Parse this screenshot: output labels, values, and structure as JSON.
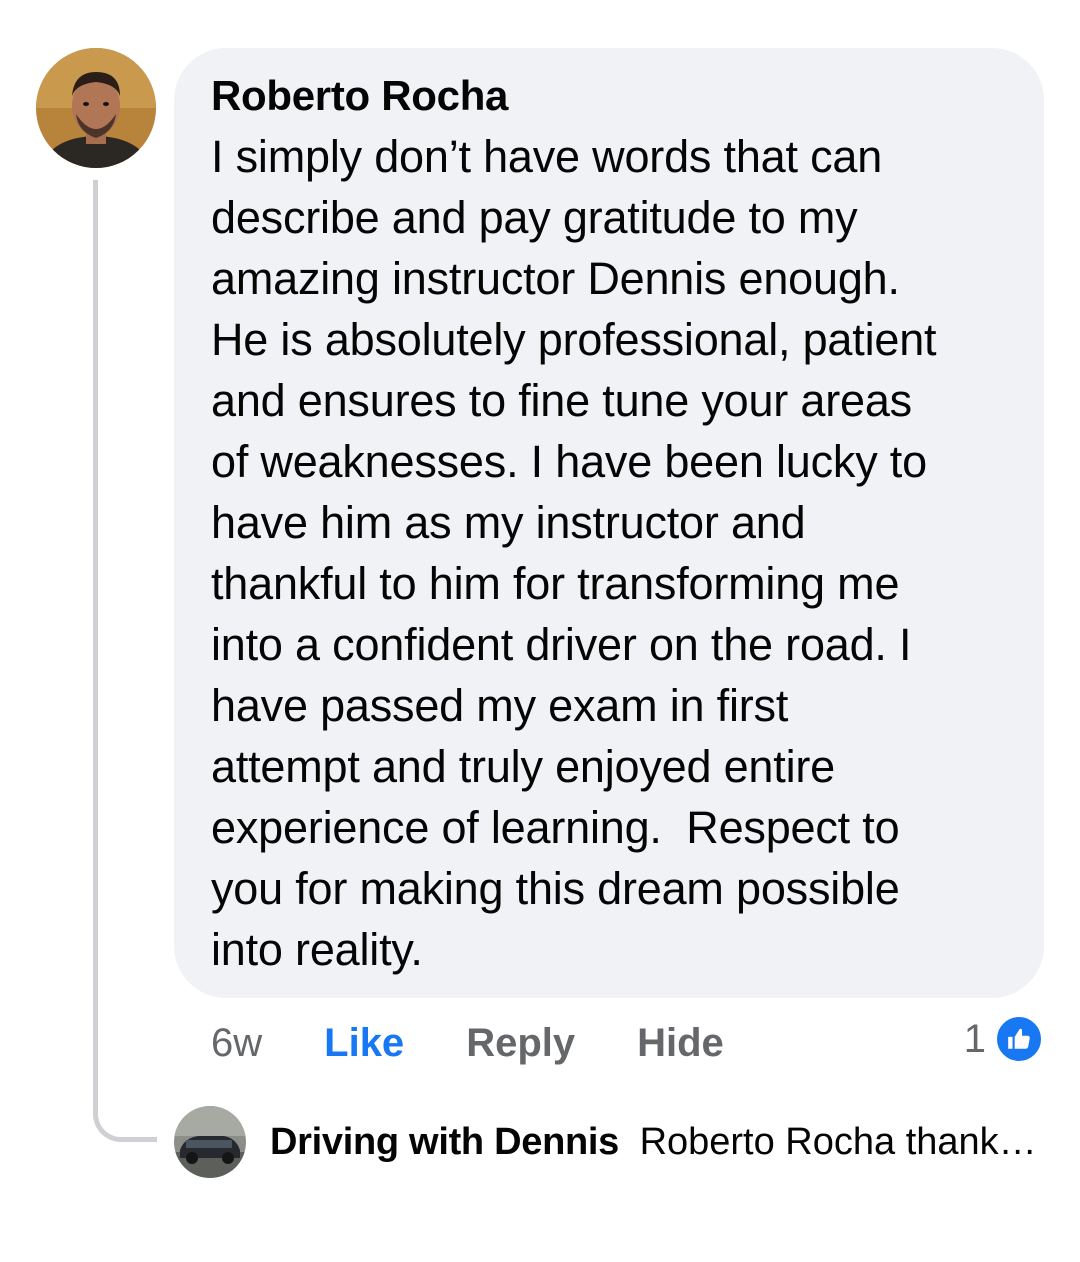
{
  "comment": {
    "author": "Roberto Rocha",
    "text": "I simply don’t have words that can describe and pay gratitude to my amazing instructor Dennis enough. He is absolutely professional, patient and ensures to fine tune your areas of weaknesses. I have been lucky to have him as my instructor and thankful to him for transforming me into a confident driver on the road. I have passed my exam in first attempt and truly enjoyed entire experience of learning.  Respect to you for making this dream possible into reality.",
    "text_lines": [
      "I simply don’t have words that can",
      "describe and pay gratitude to my",
      "amazing instructor Dennis enough.",
      "He is absolutely professional, patient",
      "and ensures to fine tune your areas",
      "of weaknesses. I have been lucky to",
      "have him as my instructor and",
      "thankful to him for transforming me",
      "into a confident driver on the road. I",
      "have passed my exam in first",
      "attempt and truly enjoyed entire",
      "experience of learning.  Respect to",
      "you for making this dream possible",
      "into reality."
    ],
    "timestamp": "6w",
    "actions": {
      "like": "Like",
      "reply": "Reply",
      "hide": "Hide"
    },
    "reaction_count": "1",
    "reaction_icon": "thumbs-up-icon"
  },
  "reply": {
    "author": "Driving with Dennis",
    "snippet": "Roberto Rocha thank…"
  },
  "colors": {
    "bubble": "#f0f2f5",
    "like": "#1877f2",
    "muted": "#65676b",
    "thread_line": "#ced0d4"
  }
}
